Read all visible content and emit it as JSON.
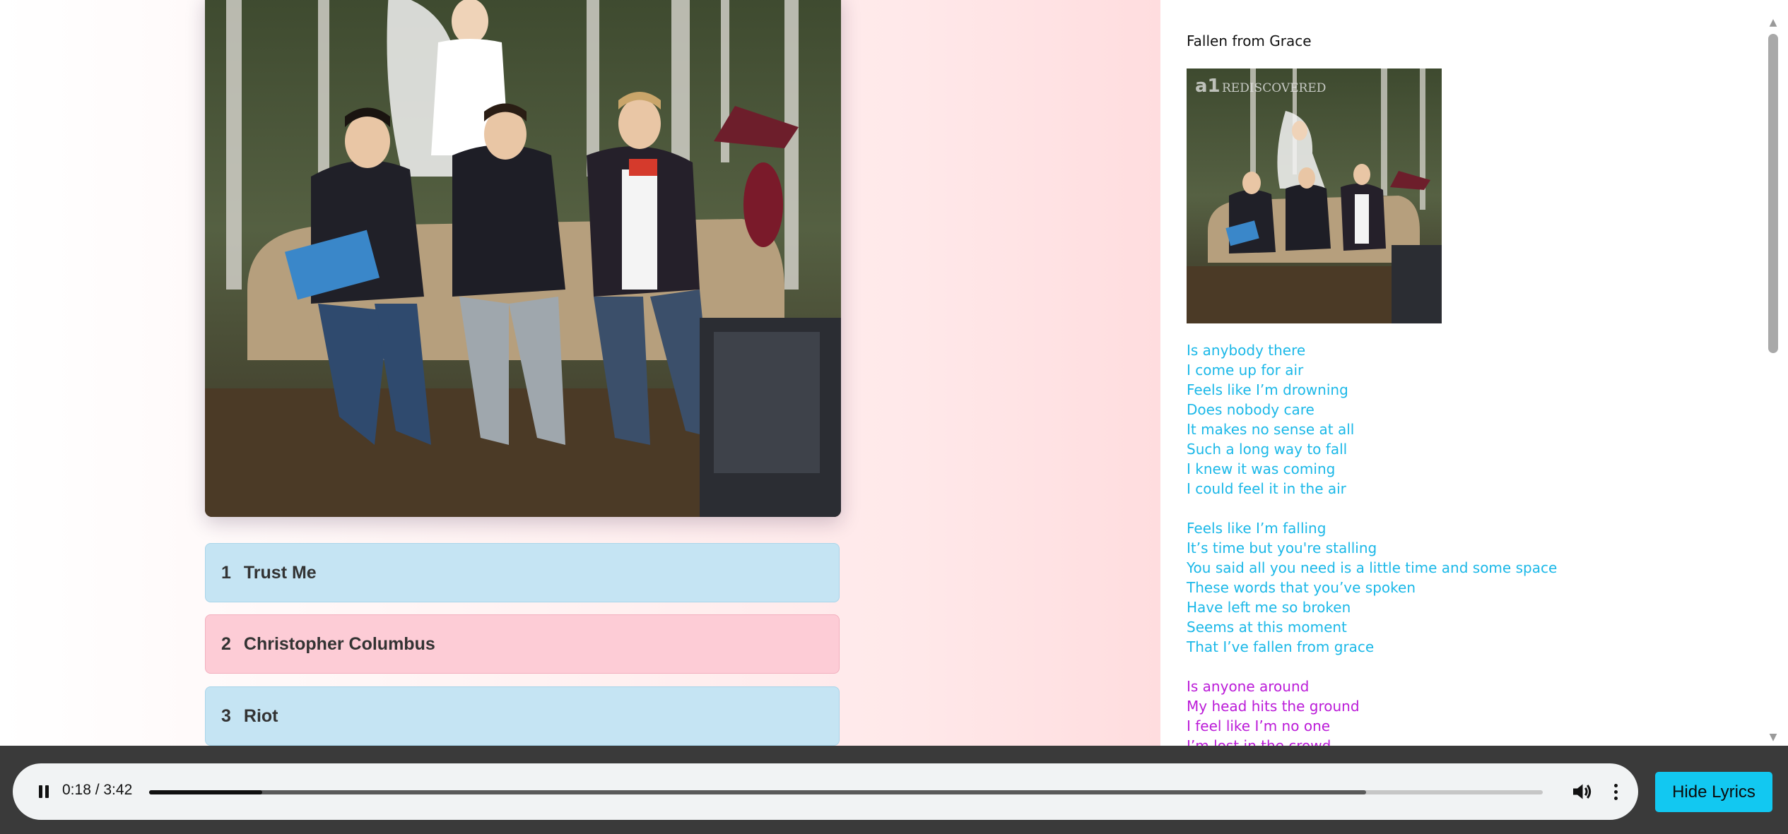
{
  "tracks": [
    {
      "number": "1",
      "title": "Trust Me",
      "color": "#c5e4f3"
    },
    {
      "number": "2",
      "title": "Christopher Columbus",
      "color": "#fdccd6"
    },
    {
      "number": "3",
      "title": "Riot",
      "color": "#c5e4f3"
    }
  ],
  "lyrics": {
    "song_title": "Fallen from Grace",
    "cover_text_logo": "a1",
    "cover_text_sub": "REDISCOVERED",
    "stanzas": [
      {
        "color": "#1bb8e8",
        "lines": [
          "Is anybody there",
          "I come up for air",
          "Feels like I’m drowning",
          "Does nobody care",
          "It makes no sense at all",
          "Such a long way to fall",
          "I knew it was coming",
          "I could feel it in the air"
        ]
      },
      {
        "color": "#1bb8e8",
        "lines": [
          "Feels like I’m falling",
          "It’s time but you're stalling",
          "You said all you need is a little time and some space",
          "These words that you’ve spoken",
          "Have left me so broken",
          "Seems at this moment",
          "That I’ve fallen from grace"
        ]
      },
      {
        "color": "#bb1bd8",
        "lines": [
          "Is anyone around",
          "My head hits the ground",
          "I feel like I’m no one",
          "I’m lost in the crowd"
        ]
      }
    ]
  },
  "player": {
    "time_display": "0:18 / 3:42",
    "current_seconds": 18,
    "duration_seconds": 222,
    "buffered_fraction": 0.873,
    "state": "playing",
    "icons": {
      "play_pause": "pause-icon",
      "volume": "volume-icon",
      "more": "more-vertical-icon"
    }
  },
  "hide_lyrics_label": "Hide Lyrics",
  "colors": {
    "accent_button": "#12c8f1",
    "bottom_bar": "#3a3a3a"
  }
}
